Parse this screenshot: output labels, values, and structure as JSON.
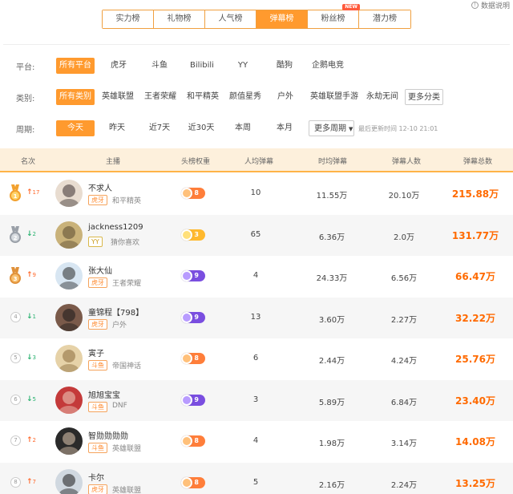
{
  "top_tabs": [
    {
      "label": "实力榜",
      "active": false
    },
    {
      "label": "礼物榜",
      "active": false
    },
    {
      "label": "人气榜",
      "active": false
    },
    {
      "label": "弹幕榜",
      "active": true
    },
    {
      "label": "粉丝榜",
      "active": false,
      "badge": "NEW"
    },
    {
      "label": "潜力榜",
      "active": false
    }
  ],
  "data_note": "数据说明",
  "filters": {
    "platform": {
      "label": "平台:",
      "options": [
        "所有平台",
        "虎牙",
        "斗鱼",
        "Bilibili",
        "YY",
        "酷狗",
        "企鹅电竞"
      ]
    },
    "category": {
      "label": "类别:",
      "options": [
        "所有类别",
        "英雄联盟",
        "王者荣耀",
        "和平精英",
        "颜值星秀",
        "户外",
        "英雄联盟手游",
        "永劫无间"
      ],
      "more": "更多分类"
    },
    "period": {
      "label": "周期:",
      "options": [
        "今天",
        "昨天",
        "近7天",
        "近30天",
        "本周",
        "本月"
      ],
      "more": "更多周期",
      "updated": "最后更新时间 12-10 21:01"
    }
  },
  "table": {
    "headers": {
      "rank": "名次",
      "streamer": "主播",
      "weight": "头榜权重",
      "avg": "人均弹幕",
      "hourly": "时均弹幕",
      "people": "弹幕人数",
      "total": "弹幕总数"
    },
    "rows": [
      {
        "rank": "1",
        "change": "17",
        "dir": "up",
        "name": "不求人",
        "platform": "虎牙",
        "game": "和平精英",
        "weight": "8",
        "weight_color": "orange",
        "avg": "10",
        "hourly": "11.55万",
        "people": "20.10万",
        "total": "215.88万"
      },
      {
        "rank": "2",
        "change": "2",
        "dir": "down",
        "name": "jackness1209",
        "platform": "YY",
        "game": "猜你喜欢",
        "weight": "3",
        "weight_color": "yellow",
        "avg": "65",
        "hourly": "6.36万",
        "people": "2.0万",
        "total": "131.77万"
      },
      {
        "rank": "3",
        "change": "9",
        "dir": "up",
        "name": "张大仙",
        "platform": "虎牙",
        "game": "王者荣耀",
        "weight": "9",
        "weight_color": "purple",
        "avg": "4",
        "hourly": "24.33万",
        "people": "6.56万",
        "total": "66.47万"
      },
      {
        "rank": "4",
        "change": "1",
        "dir": "down",
        "name": "童锦程【798】",
        "platform": "虎牙",
        "game": "户外",
        "weight": "9",
        "weight_color": "purple",
        "avg": "13",
        "hourly": "3.60万",
        "people": "2.27万",
        "total": "32.22万"
      },
      {
        "rank": "5",
        "change": "3",
        "dir": "down",
        "name": "寅子",
        "platform": "斗鱼",
        "game": "帝国神话",
        "weight": "8",
        "weight_color": "orange",
        "avg": "6",
        "hourly": "2.44万",
        "people": "4.24万",
        "total": "25.76万"
      },
      {
        "rank": "6",
        "change": "5",
        "dir": "down",
        "name": "旭旭宝宝",
        "platform": "斗鱼",
        "game": "DNF",
        "weight": "9",
        "weight_color": "purple",
        "avg": "3",
        "hourly": "5.89万",
        "people": "6.84万",
        "total": "23.40万"
      },
      {
        "rank": "7",
        "change": "2",
        "dir": "up",
        "name": "智勋勋勋勋",
        "platform": "斗鱼",
        "game": "英雄联盟",
        "weight": "8",
        "weight_color": "orange",
        "avg": "4",
        "hourly": "1.98万",
        "people": "3.14万",
        "total": "14.08万"
      },
      {
        "rank": "8",
        "change": "7",
        "dir": "up",
        "name": "卡尔",
        "platform": "虎牙",
        "game": "英雄联盟",
        "weight": "8",
        "weight_color": "orange",
        "avg": "5",
        "hourly": "2.16万",
        "people": "2.24万",
        "total": "13.25万"
      }
    ]
  },
  "colors": {
    "accent": "#ff9a2e",
    "total": "#ff6a00",
    "up": "#ff6a2e",
    "down": "#2ab270"
  }
}
